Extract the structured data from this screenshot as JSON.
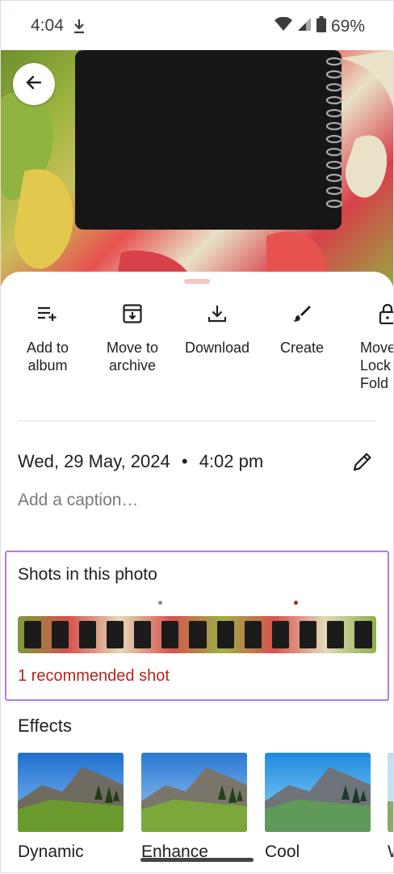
{
  "status": {
    "time": "4:04",
    "battery_pct": "69%",
    "icons": [
      "download-icon",
      "wifi-icon",
      "signal-icon",
      "battery-icon"
    ]
  },
  "photo": {
    "back_icon": "arrow-left-icon"
  },
  "actions": [
    {
      "label": "Add to\nalbum",
      "icon": "playlist-add-icon"
    },
    {
      "label": "Move to\narchive",
      "icon": "archive-icon"
    },
    {
      "label": "Download",
      "icon": "download-icon"
    },
    {
      "label": "Create",
      "icon": "brush-icon"
    },
    {
      "label": "Move\nLock\nFold",
      "icon": "lock-icon"
    }
  ],
  "details": {
    "date": "Wed, 29 May, 2024",
    "separator": "•",
    "time": "4:02 pm",
    "caption_placeholder": "Add a caption…"
  },
  "shots": {
    "title": "Shots in this photo",
    "recommended": "1 recommended shot"
  },
  "effects": {
    "title": "Effects",
    "items": [
      {
        "name": "Dynamic"
      },
      {
        "name": "Enhance"
      },
      {
        "name": "Cool"
      },
      {
        "name": "W"
      }
    ]
  },
  "colors": {
    "accent_red": "#b3261e",
    "highlight_border": "#b57be3"
  }
}
